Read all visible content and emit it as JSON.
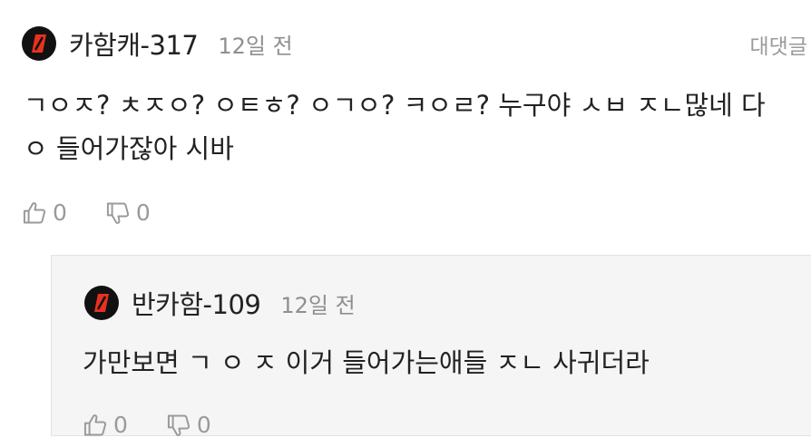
{
  "comment": {
    "author": "카함캐-317",
    "time": "12일 전",
    "reply_label": "대댓글",
    "line1": "ㄱㅇㅈ? ㅊㅈㅇ? ㅇㅌㅎ? ㅇㄱㅇ? ㅋㅇㄹ? 누구야 ㅅㅂ ㅈㄴ많네 다",
    "line2": "ㅇ 들어가잖아 시바",
    "likes": "0",
    "dislikes": "0"
  },
  "reply": {
    "author": "반카함-109",
    "time": "12일 전",
    "text": "가만보면 ㄱ ㅇ ㅈ 이거 들어가는애들 ㅈㄴ 사귀더라",
    "likes": "0",
    "dislikes": "0"
  },
  "colors": {
    "avatar_bg": "#111111",
    "avatar_mark": "#e8321e",
    "muted": "#9a9a9a"
  },
  "icons": [
    "avatar-logo-icon",
    "thumbs-up-icon",
    "thumbs-down-icon"
  ]
}
